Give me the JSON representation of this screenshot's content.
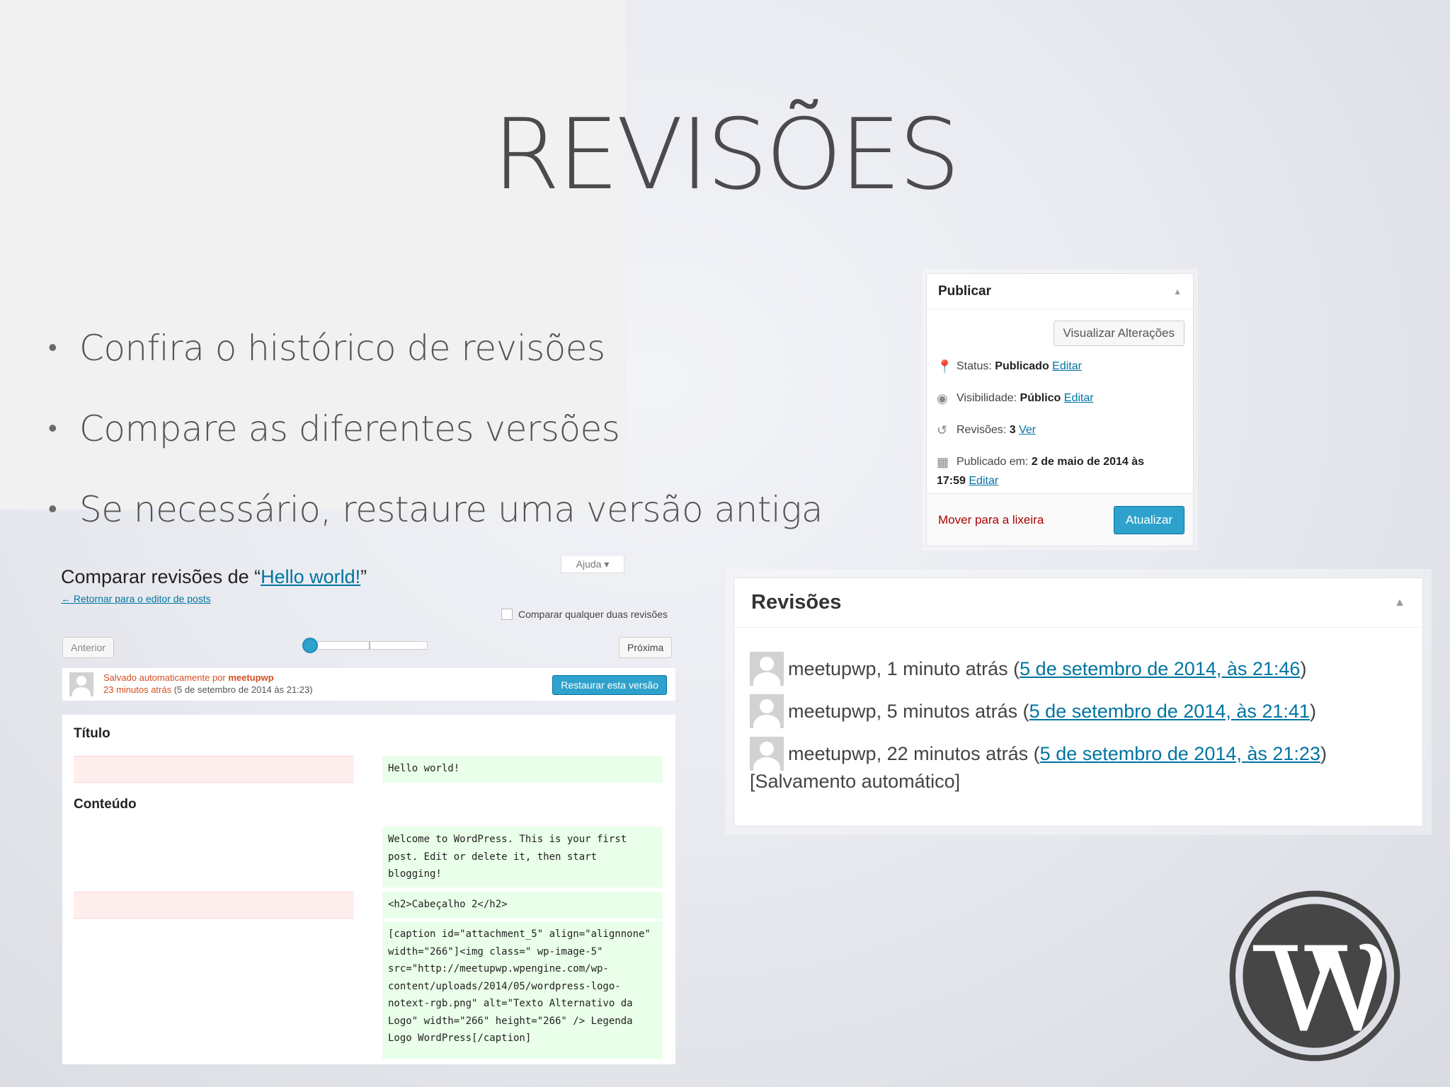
{
  "slide": {
    "title": "REVISÕES",
    "bullets": [
      "Confira o histórico de revisões",
      "Compare as diferentes versões",
      "Se necessário, restaure uma versão antiga"
    ]
  },
  "publish_box": {
    "title": "Publicar",
    "preview_button": "Visualizar Alterações",
    "status_label": "Status:",
    "status_value": "Publicado",
    "visibility_label": "Visibilidade:",
    "visibility_value": "Público",
    "revisions_label": "Revisões:",
    "revisions_value": "3",
    "revisions_link": "Ver",
    "published_label": "Publicado em:",
    "published_value_line1": "2 de maio de 2014 às",
    "published_value_line2": "17:59",
    "edit_link": "Editar",
    "trash_link": "Mover para a lixeira",
    "update_button": "Atualizar",
    "icons": [
      "pin-icon",
      "eye-icon",
      "history-icon",
      "calendar-icon"
    ]
  },
  "revisions_box": {
    "title": "Revisões",
    "items": [
      {
        "text": "meetupwp, 1 minuto atrás (",
        "link": "5 de setembro de 2014, às 21:46",
        "close": ")"
      },
      {
        "text": "meetupwp, 5 minutos atrás (",
        "link": "5 de setembro de 2014, às 21:41",
        "close": ")"
      },
      {
        "text": "meetupwp, 22 minutos atrás (",
        "link": "5 de setembro de 2014, às 21:23",
        "close": ")"
      }
    ],
    "note": "[Salvamento automático]"
  },
  "compare_screen": {
    "help_tab": "Ajuda ▾",
    "title_prefix": "Comparar revisões de “",
    "title_link": "Hello world!",
    "title_suffix": "”",
    "back_link": "← Retornar para o editor de posts",
    "compare_any_label": "Comparar qualquer duas revisões",
    "prev_button": "Anterior",
    "next_button": "Próxima",
    "autosave_prefix": "Salvado automaticamente por ",
    "autosave_author": "meetupwp",
    "time_ago": "23 minutos atrás",
    "time_exact": " (5 de setembro de 2014 às 21:23)",
    "restore_button": "Restaurar esta versão",
    "title_label": "Título",
    "content_label": "Conteúdo",
    "diff_title_new": "Hello world!",
    "diff_content_1": "Welcome to WordPress. This is your first\npost. Edit or delete it, then start\nblogging!",
    "diff_content_2": "<h2>Cabeçalho 2</h2>",
    "diff_content_3": "[caption id=\"attachment_5\" align=\"alignnone\"\nwidth=\"266\"]<img class=\" wp-image-5\"\nsrc=\"http://meetupwp.wpengine.com/wp-\ncontent/uploads/2014/05/wordpress-logo-\nnotext-rgb.png\" alt=\"Texto Alternativo da\nLogo\" width=\"266\" height=\"266\" /> Legenda\nLogo WordPress[/caption]"
  },
  "colors": {
    "wp_blue": "#2ea2cc",
    "link_blue": "#0074a2",
    "trash_red": "#aa0000",
    "autosave_orange": "#d54e21",
    "diff_deleted": "#ffeeee",
    "diff_added": "#e9ffe9",
    "logo_gray": "#464646"
  }
}
